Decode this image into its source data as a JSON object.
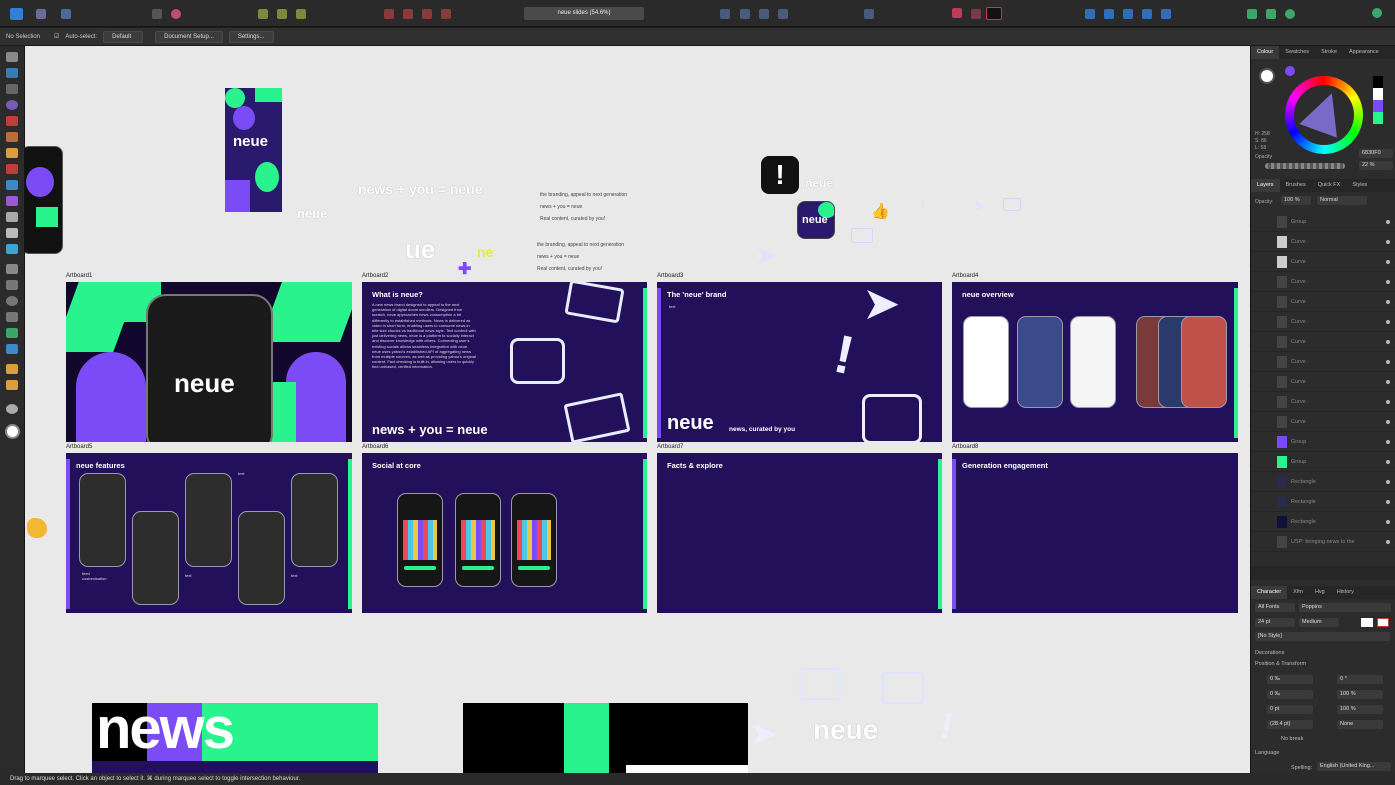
{
  "window": {
    "doc_tab": "neue slides (54.6%)"
  },
  "context": {
    "selection": "No Selection",
    "auto_select_label": "Auto-select:",
    "auto_select_value": "Default",
    "doc_setup": "Document Setup...",
    "settings": "Settings..."
  },
  "canvas": {
    "artboards": [
      {
        "label": "Artboard1"
      },
      {
        "label": "Artboard2",
        "heading": "What is neue?"
      },
      {
        "label": "Artboard3",
        "heading": "The 'neue' brand",
        "sub": "text"
      },
      {
        "label": "Artboard4",
        "heading": "neue overview"
      },
      {
        "label": "Artboard5",
        "heading": "neue features",
        "t1": "text",
        "t2": "text",
        "t3": "text",
        "t4": "feed\ncustomisation"
      },
      {
        "label": "Artboard6",
        "heading": "Social at core"
      },
      {
        "label": "Artboard7",
        "heading": "Facts & explore"
      },
      {
        "label": "Artboard8",
        "heading": "Generation engagement"
      }
    ],
    "ab1_wordmark": "neue",
    "ab2_body": "A new news brand designed to appeal to the next generation of digital doom scrollers. Designed from scratch, neue approaches news consumption a bit differently to established methods. News is delivered as video in short form, enabling users to consume news in bite size chunks vs traditional news style. Text content with just delivering news, neue is a platform to socially interact and discover knowledge with others. Connecting user's existing socials allows seamless integration with neue. neue uses yahoo's established API of aggregating news from multiple sources, as well as providing yahoo's original content. Fact checking is built in, allowing users to quickly find unbiased, verified information.",
    "ab2_footer": "news + you = neue",
    "ab3_wordmark": "neue",
    "ab3_tag": "news, curated by you",
    "top_equation": "news + you = neue",
    "lines": [
      "the branding, appeal to next generation",
      "news + you = neue",
      "Real content, curated by you!",
      "the branding, appeal to next generation",
      "news + you = neue",
      "Real content, curated by you!"
    ],
    "small_wordmark": "neue",
    "big_ue": "ue",
    "news_banner": "news",
    "bottom_wordmark": "neue",
    "icon_wordmark": "neue",
    "tile_wordmark": "neue"
  },
  "status": {
    "text": "Drag to marquee select. Click an object to select it. ⌘ during marquee select to toggle intersection behaviour."
  },
  "right": {
    "tabs1": [
      "Colour",
      "Swatches",
      "Stroke",
      "Appearance"
    ],
    "hsl": [
      "H: 258",
      "S: 86",
      "L: 58"
    ],
    "hex": "6830F0",
    "opacity_label": "Opacity",
    "opacity_val": "22 %",
    "tabs2": [
      "Layers",
      "Brushes",
      "Quick FX",
      "Styles"
    ],
    "layer_opacity": "Opacity:",
    "layer_opacity_val": "100 %",
    "blend": "Normal",
    "layers": [
      "Group",
      "Curve",
      "Curve",
      "Curve",
      "Curve",
      "Curve",
      "Curve",
      "Curve",
      "Curve",
      "Curve",
      "Curve",
      "Group",
      "Group",
      "Rectangle",
      "Rectangle",
      "Rectangle",
      "USP: bringing news to the"
    ],
    "tabs3": [
      "Character",
      "Xfm",
      "Hvg",
      "History"
    ],
    "font_col": "All Fonts",
    "font": "Poppins",
    "size": "24 pt",
    "weight": "Medium",
    "style": "[No Style]",
    "decorations": "Decorations",
    "pos_transform": "Position & Transform",
    "fields": [
      "0 ‰",
      "0 °",
      "0 ‰",
      "100 %",
      "0 pt",
      "100 %",
      "(28.4 pt)",
      "None"
    ],
    "nobreak": "No break",
    "language": "Language",
    "spelling_label": "Spelling:",
    "spelling": "English (United King..."
  }
}
